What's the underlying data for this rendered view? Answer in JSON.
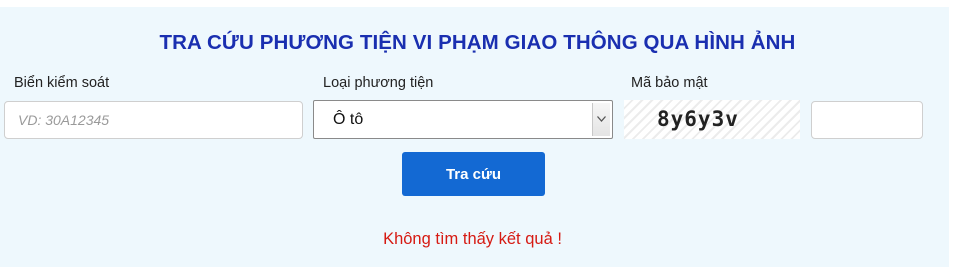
{
  "title": "TRA CỨU PHƯƠNG TIỆN VI PHẠM GIAO THÔNG QUA HÌNH ẢNH",
  "form": {
    "plate_label": "Biển kiểm soát",
    "plate_placeholder": "VD: 30A12345",
    "plate_value": "",
    "vehicle_label": "Loại phương tiện",
    "vehicle_selected": "Ô tô",
    "captcha_label": "Mã bảo mật",
    "captcha_text": "8y6y3v",
    "captcha_value": "",
    "submit_label": "Tra cứu"
  },
  "result": {
    "message": "Không tìm thấy kết quả !"
  },
  "colors": {
    "title": "#1a2fb0",
    "button": "#1369d3",
    "error": "#d61a12",
    "panel_bg": "#eef8fd"
  }
}
